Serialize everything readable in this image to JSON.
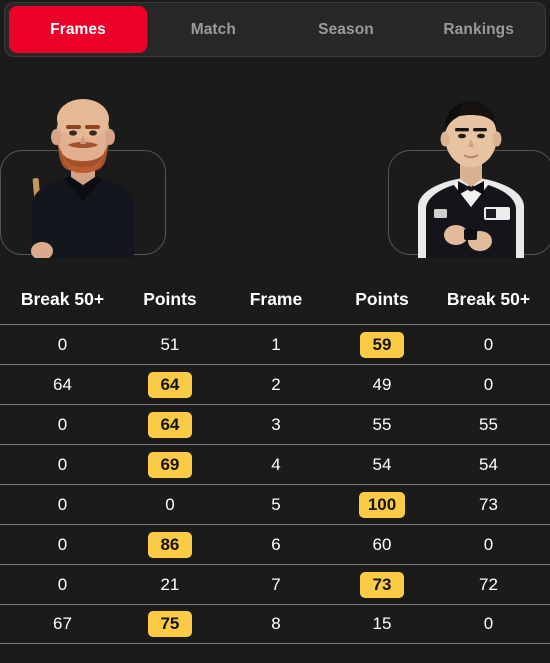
{
  "theme": {
    "background": "#1b1b1b",
    "tabbar_bg": "#282828",
    "accent_red": "#ec0029",
    "highlight_yellow": "#fbcb46",
    "divider": "#787878",
    "inactive_text": "#9a9a9a"
  },
  "tabs": [
    {
      "label": "Frames",
      "active": true
    },
    {
      "label": "Match",
      "active": false
    },
    {
      "label": "Season",
      "active": false
    },
    {
      "label": "Rankings",
      "active": false
    }
  ],
  "players": {
    "left": {
      "icon": "player-photo-left",
      "description": "bald player with red beard, dark shirt and bow tie, holding cue"
    },
    "right": {
      "icon": "player-photo-right",
      "description": "player with dark hair, white shirt and black waistcoat, holding chalk"
    }
  },
  "table": {
    "headers": [
      "Break 50+",
      "Points",
      "Frame",
      "Points",
      "Break 50+"
    ],
    "rows": [
      {
        "left_break": "0",
        "left_points": "51",
        "left_win": false,
        "frame": "1",
        "right_points": "59",
        "right_win": true,
        "right_break": "0"
      },
      {
        "left_break": "64",
        "left_points": "64",
        "left_win": true,
        "frame": "2",
        "right_points": "49",
        "right_win": false,
        "right_break": "0"
      },
      {
        "left_break": "0",
        "left_points": "64",
        "left_win": true,
        "frame": "3",
        "right_points": "55",
        "right_win": false,
        "right_break": "55"
      },
      {
        "left_break": "0",
        "left_points": "69",
        "left_win": true,
        "frame": "4",
        "right_points": "54",
        "right_win": false,
        "right_break": "54"
      },
      {
        "left_break": "0",
        "left_points": "0",
        "left_win": false,
        "frame": "5",
        "right_points": "100",
        "right_win": true,
        "right_break": "73"
      },
      {
        "left_break": "0",
        "left_points": "86",
        "left_win": true,
        "frame": "6",
        "right_points": "60",
        "right_win": false,
        "right_break": "0"
      },
      {
        "left_break": "0",
        "left_points": "21",
        "left_win": false,
        "frame": "7",
        "right_points": "73",
        "right_win": true,
        "right_break": "72"
      },
      {
        "left_break": "67",
        "left_points": "75",
        "left_win": true,
        "frame": "8",
        "right_points": "15",
        "right_win": false,
        "right_break": "0"
      }
    ]
  }
}
